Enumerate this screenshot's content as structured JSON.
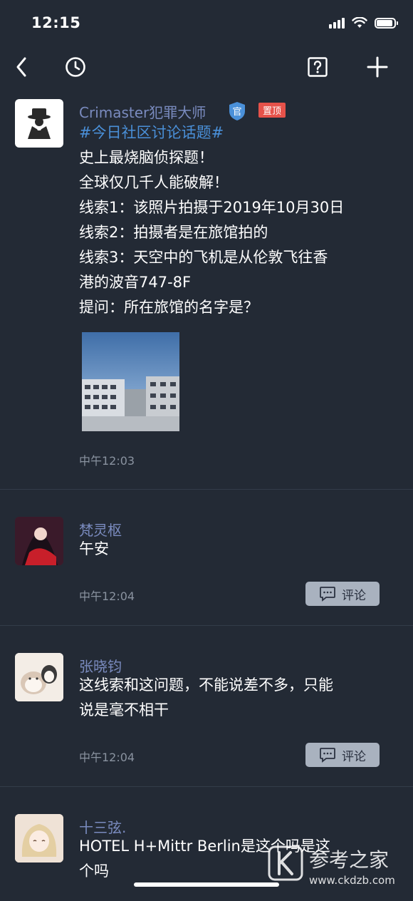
{
  "status_bar": {
    "time": "12:15"
  },
  "posts": [
    {
      "username": "Crimaster犯罪大师",
      "official_badge": "官",
      "pinned_badge": "置顶",
      "hashtag": "#今日社区讨论话题#",
      "lines": [
        "史上最烧脑侦探题！",
        "全球仅几千人能破解！",
        "线索1：该照片拍摄于2019年10月30日",
        "线索2：拍摄者是在旅馆拍的",
        "线索3：天空中的飞机是从伦敦飞往香",
        "港的波音747-8F",
        "提问：所在旅馆的名字是？"
      ],
      "time": "中午12:03"
    },
    {
      "username": "梵灵枢",
      "lines": [
        "午安"
      ],
      "time": "中午12:04",
      "comment_label": "评论"
    },
    {
      "username": "张晓钧",
      "lines": [
        "这线索和这问题，不能说差不多，只能",
        "说是毫不相干"
      ],
      "time": "中午12:04",
      "comment_label": "评论"
    },
    {
      "username": "十三弦.",
      "lines": [
        "HOTEL H+Mittr Berlin是这个吗是这",
        "个吗"
      ]
    }
  ],
  "watermark": {
    "brand": "参考之家",
    "url": "www.ckdzb.com"
  },
  "colors": {
    "background": "#232a35",
    "username": "#7a8bbf",
    "hashtag": "#4a90d9",
    "pinned": "#e6524a"
  },
  "icons": [
    "back-icon",
    "history-clock-icon",
    "help-icon",
    "add-icon",
    "comment-bubble-icon",
    "wifi-icon",
    "signal-icon",
    "battery-icon"
  ]
}
